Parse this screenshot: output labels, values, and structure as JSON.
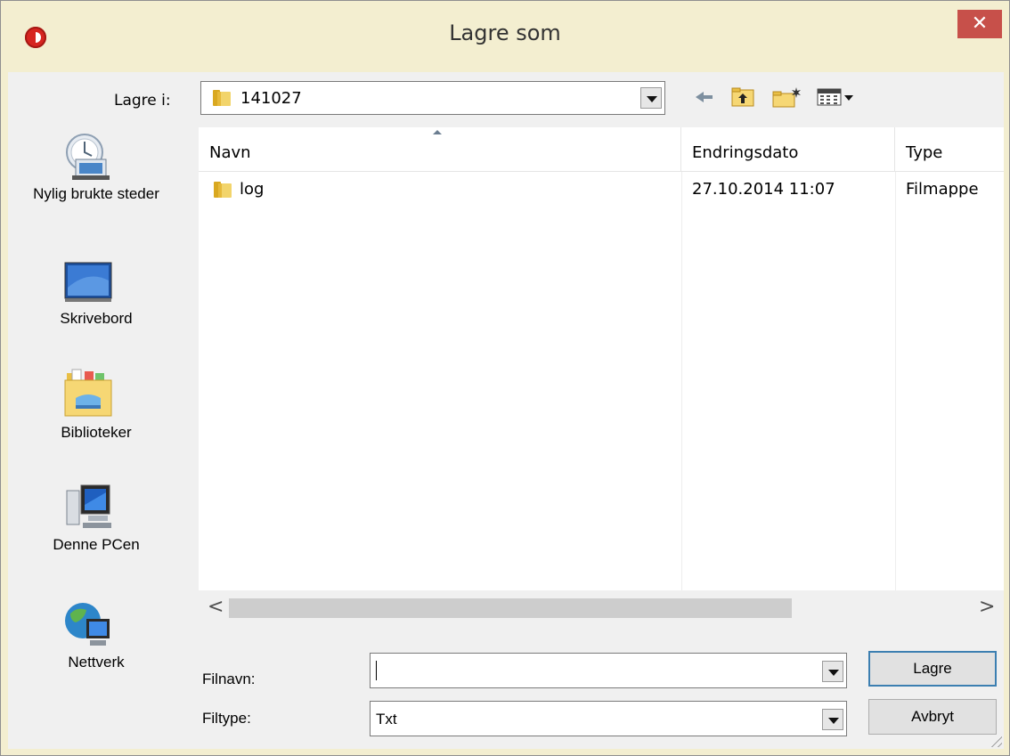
{
  "window": {
    "title": "Lagre som",
    "close_glyph": "✕"
  },
  "toolbar": {
    "look_in_label": "Lagre i:",
    "look_in_value": "141027",
    "icons": [
      "back-arrow-icon",
      "up-one-level-icon",
      "new-folder-icon",
      "view-menu-icon"
    ]
  },
  "places": [
    {
      "label": "Nylig brukte steder",
      "icon": "recent-places-icon"
    },
    {
      "label": "Skrivebord",
      "icon": "desktop-icon"
    },
    {
      "label": "Biblioteker",
      "icon": "libraries-icon"
    },
    {
      "label": "Denne PCen",
      "icon": "this-pc-icon"
    },
    {
      "label": "Nettverk",
      "icon": "network-icon"
    }
  ],
  "file_list": {
    "columns": [
      "Navn",
      "Endringsdato",
      "Type"
    ],
    "rows": [
      {
        "name": "log",
        "modified": "27.10.2014 11:07",
        "type": "Filmappe"
      }
    ],
    "scroll_left_glyph": "<",
    "scroll_right_glyph": ">"
  },
  "filename": {
    "label": "Filnavn:",
    "value": ""
  },
  "filetype": {
    "label": "Filtype:",
    "value": "Txt"
  },
  "buttons": {
    "save": "Lagre",
    "cancel": "Avbryt"
  },
  "colors": {
    "titlebar": "#f3eed0",
    "close": "#c7504a",
    "client": "#f0f0f0"
  }
}
